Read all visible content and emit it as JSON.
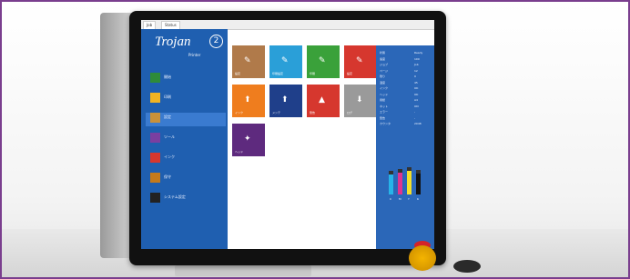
{
  "tabs": [
    "Job",
    "Status"
  ],
  "logo": {
    "text": "Trojan",
    "number": "2",
    "subtitle": "Printer"
  },
  "sidebar": {
    "items": [
      {
        "label": "開始",
        "color": "#2e8b3a",
        "icon": "user-icon"
      },
      {
        "label": "印刷",
        "color": "#f0b323",
        "icon": "folder-icon"
      },
      {
        "label": "設定",
        "color": "#c9913a",
        "icon": "wrench-icon",
        "active": true
      },
      {
        "label": "ツール",
        "color": "#7b3fa0",
        "icon": "tool-icon"
      },
      {
        "label": "インク",
        "color": "#d6372e",
        "icon": "ink-icon"
      },
      {
        "label": "保守",
        "color": "#c47a1c",
        "icon": "maintenance-icon"
      },
      {
        "label": "システム設定",
        "color": "#222222",
        "icon": "settings-icon"
      }
    ]
  },
  "tiles": [
    {
      "label": "設定",
      "color": "#b07a4a",
      "icon": "wrench-icon"
    },
    {
      "label": "印刷設定",
      "color": "#2a9fd8",
      "icon": "wrench-icon"
    },
    {
      "label": "印刷",
      "color": "#3aa13a",
      "icon": "wrench-icon"
    },
    {
      "label": "設定",
      "color": "#d6372e",
      "icon": "wrench-icon"
    },
    {
      "label": "インク",
      "color": "#ef7d1e",
      "icon": "upload-icon"
    },
    {
      "label": "メンテ",
      "color": "#1f3f8a",
      "icon": "upload-icon"
    },
    {
      "label": "警告",
      "color": "#d6372e",
      "icon": "warning-icon"
    },
    {
      "label": "ログ",
      "color": "#9a9a9a",
      "icon": "download-icon"
    },
    {
      "label": "ヘッド",
      "color": "#5e2a7e",
      "icon": "heads-icon"
    }
  ],
  "status": {
    "rows": [
      {
        "k": "状態",
        "v": "Ready"
      },
      {
        "k": "速度",
        "v": "100"
      },
      {
        "k": "ジョブ",
        "v": "Job"
      },
      {
        "k": "ページ",
        "v": "12"
      },
      {
        "k": "残り",
        "v": "0"
      },
      {
        "k": "温度",
        "v": "45"
      },
      {
        "k": "インク",
        "v": "OK"
      },
      {
        "k": "ヘッド",
        "v": "OK"
      },
      {
        "k": "用紙",
        "v": "A4"
      },
      {
        "k": "ネット",
        "v": "ON"
      },
      {
        "k": "エラー",
        "v": "-"
      },
      {
        "k": "警告",
        "v": "-"
      },
      {
        "k": "カウンタ",
        "v": "2048"
      }
    ],
    "inks": [
      {
        "name": "C",
        "color": "#27b4e8",
        "level": 0.55
      },
      {
        "name": "M",
        "color": "#e0338f",
        "level": 0.6
      },
      {
        "name": "Y",
        "color": "#f4e02a",
        "level": 0.65
      },
      {
        "name": "K",
        "color": "#111111",
        "level": 0.58
      }
    ]
  }
}
